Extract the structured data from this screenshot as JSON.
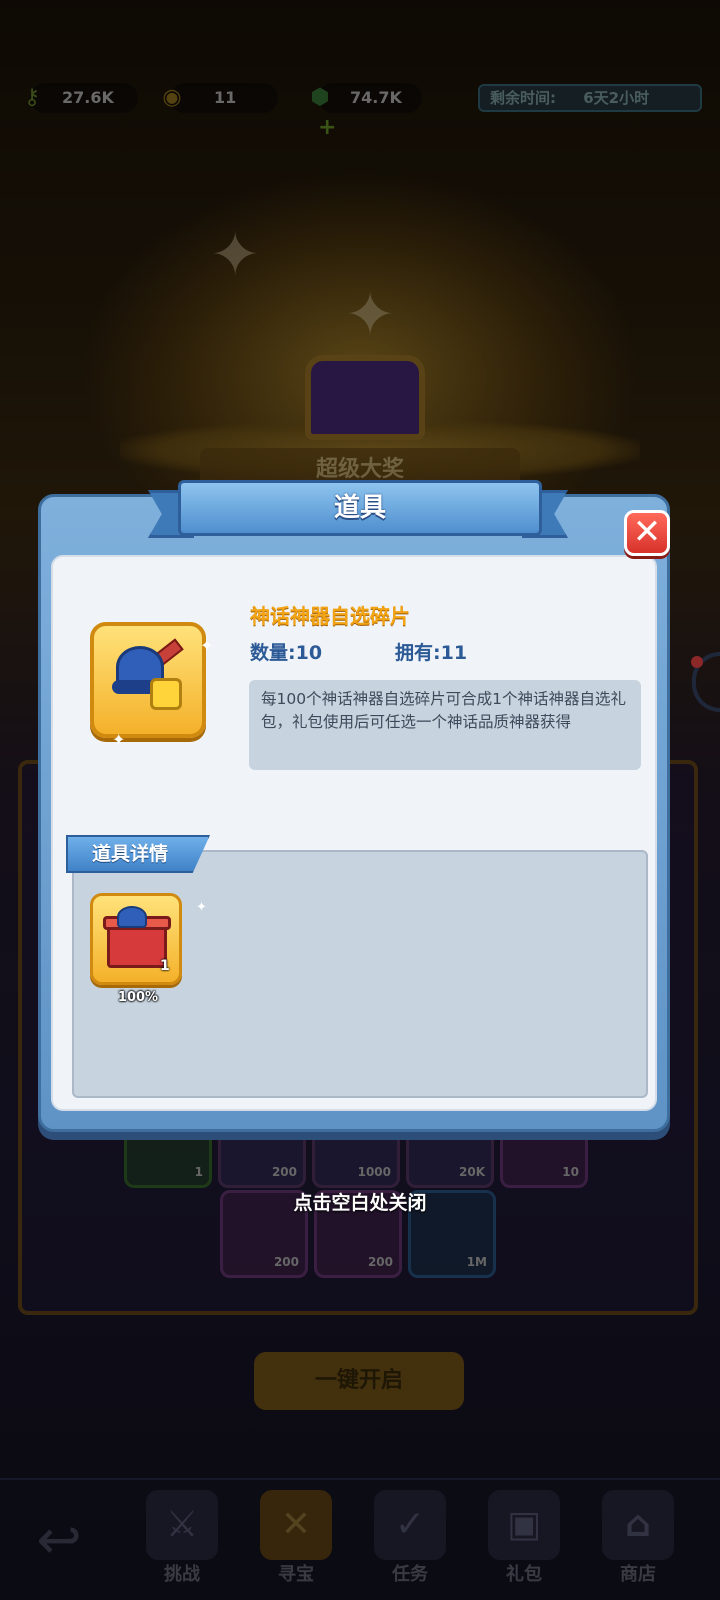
{
  "resources": {
    "keys": "27.6K",
    "coins": "11",
    "gems": "74.7K",
    "gems_add": "+",
    "timer_label": "剩余时间:",
    "timer_value": "6天2小时"
  },
  "background": {
    "banner_text": "超级大奖",
    "open_all_label": "一键开启",
    "slots_row1": [
      "1",
      "200",
      "1000",
      "20K",
      "10"
    ],
    "slots_row2": [
      "200",
      "200",
      "1M"
    ]
  },
  "bottom_nav": {
    "items": [
      {
        "label": "挑战",
        "icon": "crossed-swords-icon"
      },
      {
        "label": "寻宝",
        "icon": "treasure-map-icon",
        "active": true
      },
      {
        "label": "任务",
        "icon": "task-board-icon"
      },
      {
        "label": "礼包",
        "icon": "gift-icon"
      },
      {
        "label": "商店",
        "icon": "shop-icon"
      }
    ]
  },
  "modal": {
    "title": "道具",
    "close_symbol": "✕",
    "item": {
      "name": "神话神器自选碎片",
      "quantity": "数量:10",
      "owned": "拥有:11",
      "description": "每100个神话神器自选碎片可合成1个神话神器自选礼包，礼包使用后可任选一个神话品质神器获得",
      "icon": "artifact-fragment-icon"
    },
    "details_tab": "道具详情",
    "rewards": [
      {
        "icon": "artifact-gift-box-icon",
        "count": "1",
        "chance": "100%"
      }
    ]
  },
  "close_hint": "点击空白处关闭",
  "colors": {
    "modal_blue": "#5f93c6",
    "title_gold": "#f2a414",
    "label_blue": "#2c5a96",
    "close_red": "#d8322a"
  }
}
